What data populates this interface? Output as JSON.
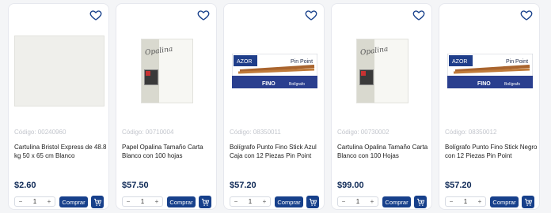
{
  "products": [
    {
      "code": "Código: 00240960",
      "title": "Cartulina Bristol Express de 48.8 kg 50 x 65 cm Blanco",
      "price": "$2.60",
      "qty": "1",
      "buy_label": "Comprar",
      "image_type": "paper-sheet"
    },
    {
      "code": "Código: 00710004",
      "title": "Papel Opalina Tamaño Carta Blanco con 100 hojas",
      "price": "$57.50",
      "qty": "1",
      "buy_label": "Comprar",
      "image_type": "opalina-pack",
      "image_text": "Opalina"
    },
    {
      "code": "Código: 08350011",
      "title": "Bolígrafo Punto Fino Stick Azul Caja con 12 Piezas Pin Point",
      "price": "$57.20",
      "qty": "1",
      "buy_label": "Comprar",
      "image_type": "pen-box",
      "brand": "AZOR",
      "product_name": "Pin Point",
      "box_label": "FINO",
      "box_small": "Bolígrafo"
    },
    {
      "code": "Código: 00730002",
      "title": "Cartulina Opalina Tamaño Carta Blanco con 100 Hojas",
      "price": "$99.00",
      "qty": "1",
      "buy_label": "Comprar",
      "image_type": "opalina-pack",
      "image_text": "Opalina"
    },
    {
      "code": "Código: 08350012",
      "title": "Bolígrafo Punto Fino Stick Negro con 12 Piezas Pin Point",
      "price": "$57.20",
      "qty": "1",
      "buy_label": "Comprar",
      "image_type": "pen-box",
      "brand": "AZOR",
      "product_name": "Pin Point",
      "box_label": "FINO",
      "box_small": "Bolígrafo"
    }
  ],
  "colors": {
    "primary": "#17408b",
    "price": "#0f2a57",
    "code": "#c3c6cd"
  },
  "icons": {
    "favorite": "heart-outline-icon",
    "cart": "cart-plus-icon"
  }
}
